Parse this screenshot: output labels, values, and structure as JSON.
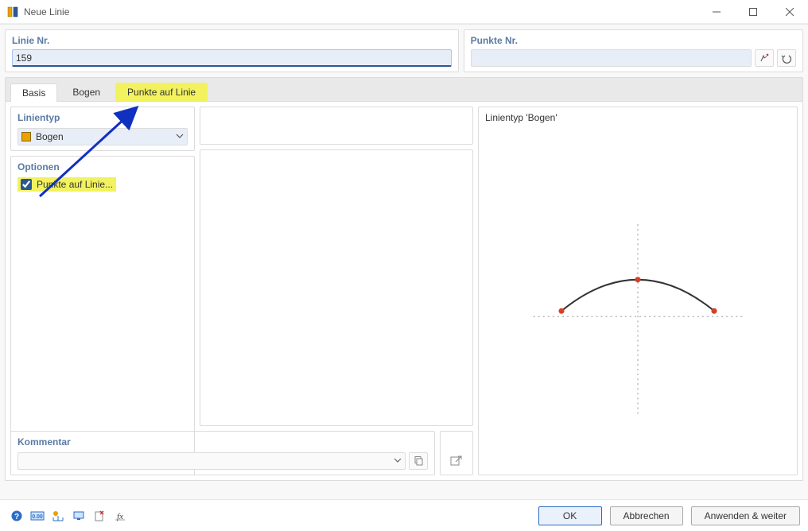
{
  "window": {
    "title": "Neue Linie"
  },
  "top": {
    "linie_nr_label": "Linie Nr.",
    "linie_nr_value": "159",
    "punkte_nr_label": "Punkte Nr.",
    "punkte_nr_value": ""
  },
  "tabs": {
    "basis": "Basis",
    "bogen": "Bogen",
    "punkte": "Punkte auf Linie"
  },
  "left": {
    "linientyp_label": "Linientyp",
    "linientyp_value": "Bogen",
    "optionen_label": "Optionen",
    "punkte_auf_linie_label": "Punkte auf Linie..."
  },
  "right": {
    "preview_title": "Linientyp 'Bogen'"
  },
  "comment": {
    "label": "Kommentar",
    "value": ""
  },
  "buttons": {
    "ok": "OK",
    "cancel": "Abbrechen",
    "apply": "Anwenden & weiter"
  },
  "icons": {
    "pick": "pick-icon",
    "undo": "undo-icon",
    "copy": "copy-icon",
    "link": "link-icon"
  },
  "colors": {
    "accent": "#2b5797",
    "highlight": "#f2f25f",
    "swatch": "#e7a200"
  }
}
